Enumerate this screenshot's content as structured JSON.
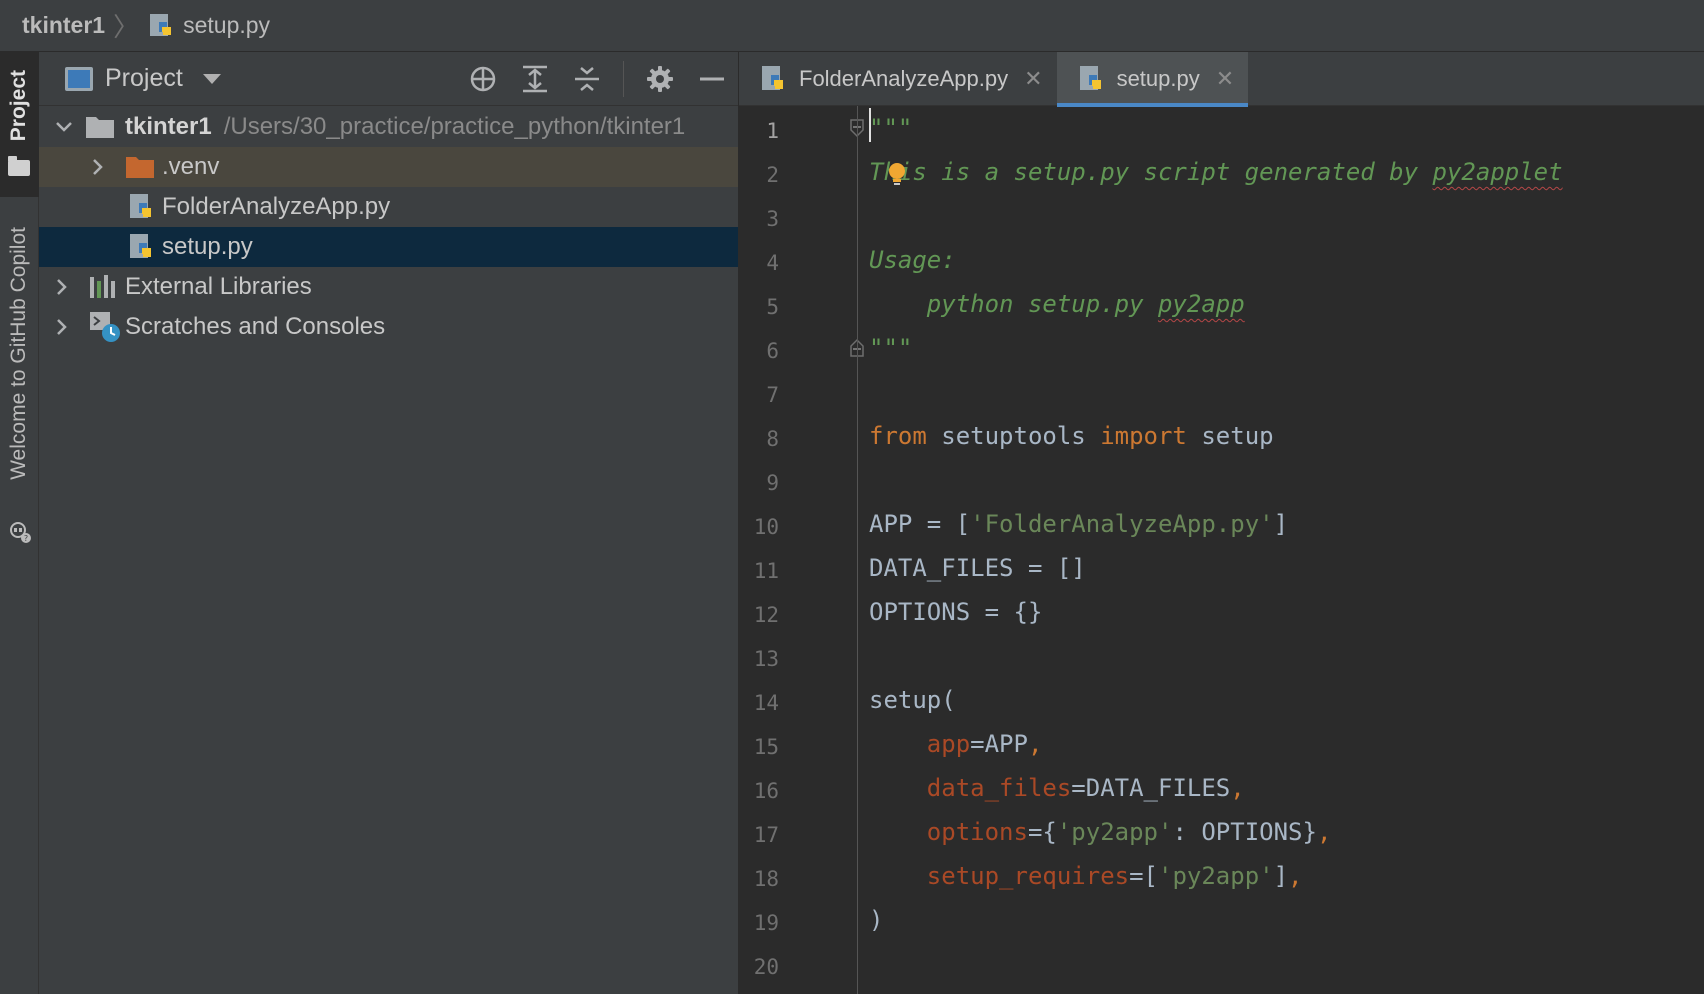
{
  "breadcrumb": {
    "root": "tkinter1",
    "file": "setup.py"
  },
  "toolstrip": {
    "project_label": "Project",
    "copilot_label": "Welcome to GitHub Copilot"
  },
  "project_panel": {
    "title": "Project",
    "tree": {
      "root_name": "tkinter1",
      "root_path": "/Users/30_practice/practice_python/tkinter1",
      "venv": ".venv",
      "file1": "FolderAnalyzeApp.py",
      "file2": "setup.py",
      "external_libraries": "External Libraries",
      "scratches": "Scratches and Consoles"
    }
  },
  "editor": {
    "tabs": [
      {
        "label": "FolderAnalyzeApp.py",
        "active": false
      },
      {
        "label": "setup.py",
        "active": true
      }
    ],
    "line_numbers": [
      "1",
      "2",
      "3",
      "4",
      "5",
      "6",
      "7",
      "8",
      "9",
      "10",
      "11",
      "12",
      "13",
      "14",
      "15",
      "16",
      "17",
      "18",
      "19",
      "20"
    ],
    "code": {
      "l1": "\"\"\"",
      "l2": "This is a setup.py script generated by ",
      "l2_word": "py2applet",
      "l4": "Usage:",
      "l5a": "    python setup.py ",
      "l5b": "py2app",
      "l6": "\"\"\"",
      "l8_from": "from",
      "l8_mod": " setuptools ",
      "l8_import": "import",
      "l8_name": " setup",
      "l10_a": "APP = [",
      "l10_s": "'FolderAnalyzeApp.py'",
      "l10_b": "]",
      "l11": "DATA_FILES = []",
      "l12": "OPTIONS = {}",
      "l14": "setup(",
      "l15_p": "app",
      "l15_v": "=APP",
      "l16_p": "data_files",
      "l16_v": "=DATA_FILES",
      "l17_p": "options",
      "l17_a": "={",
      "l17_s": "'py2app'",
      "l17_b": ": OPTIONS}",
      "l18_p": "setup_requires",
      "l18_a": "=[",
      "l18_s": "'py2app'",
      "l18_b": "]",
      "comma": ",",
      "l19": ")"
    }
  },
  "colors": {
    "background": "#2b2b2b",
    "panel": "#3c3f41",
    "selection": "#0d293e",
    "accent": "#4a88c7",
    "docstring": "#629755",
    "keyword": "#cc7832",
    "string": "#6a8759",
    "param": "#aa4926"
  }
}
